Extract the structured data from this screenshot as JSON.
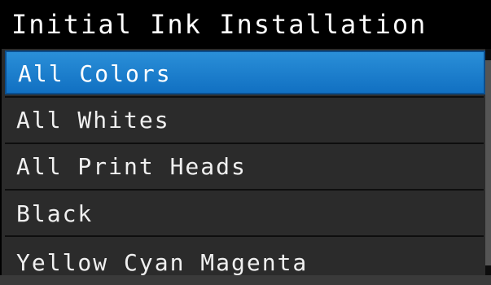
{
  "header": {
    "title": "Initial Ink Installation"
  },
  "menu": {
    "items": [
      {
        "label": "All Colors",
        "selected": true
      },
      {
        "label": "All Whites",
        "selected": false
      },
      {
        "label": "All Print Heads",
        "selected": false
      },
      {
        "label": "Black",
        "selected": false
      },
      {
        "label": "Yellow Cyan Magenta",
        "selected": false
      }
    ]
  },
  "colors": {
    "title_bg": "#000000",
    "menu_bg": "#2b2b2b",
    "selection": "#1a7fcc",
    "text": "#f0f0f0"
  }
}
